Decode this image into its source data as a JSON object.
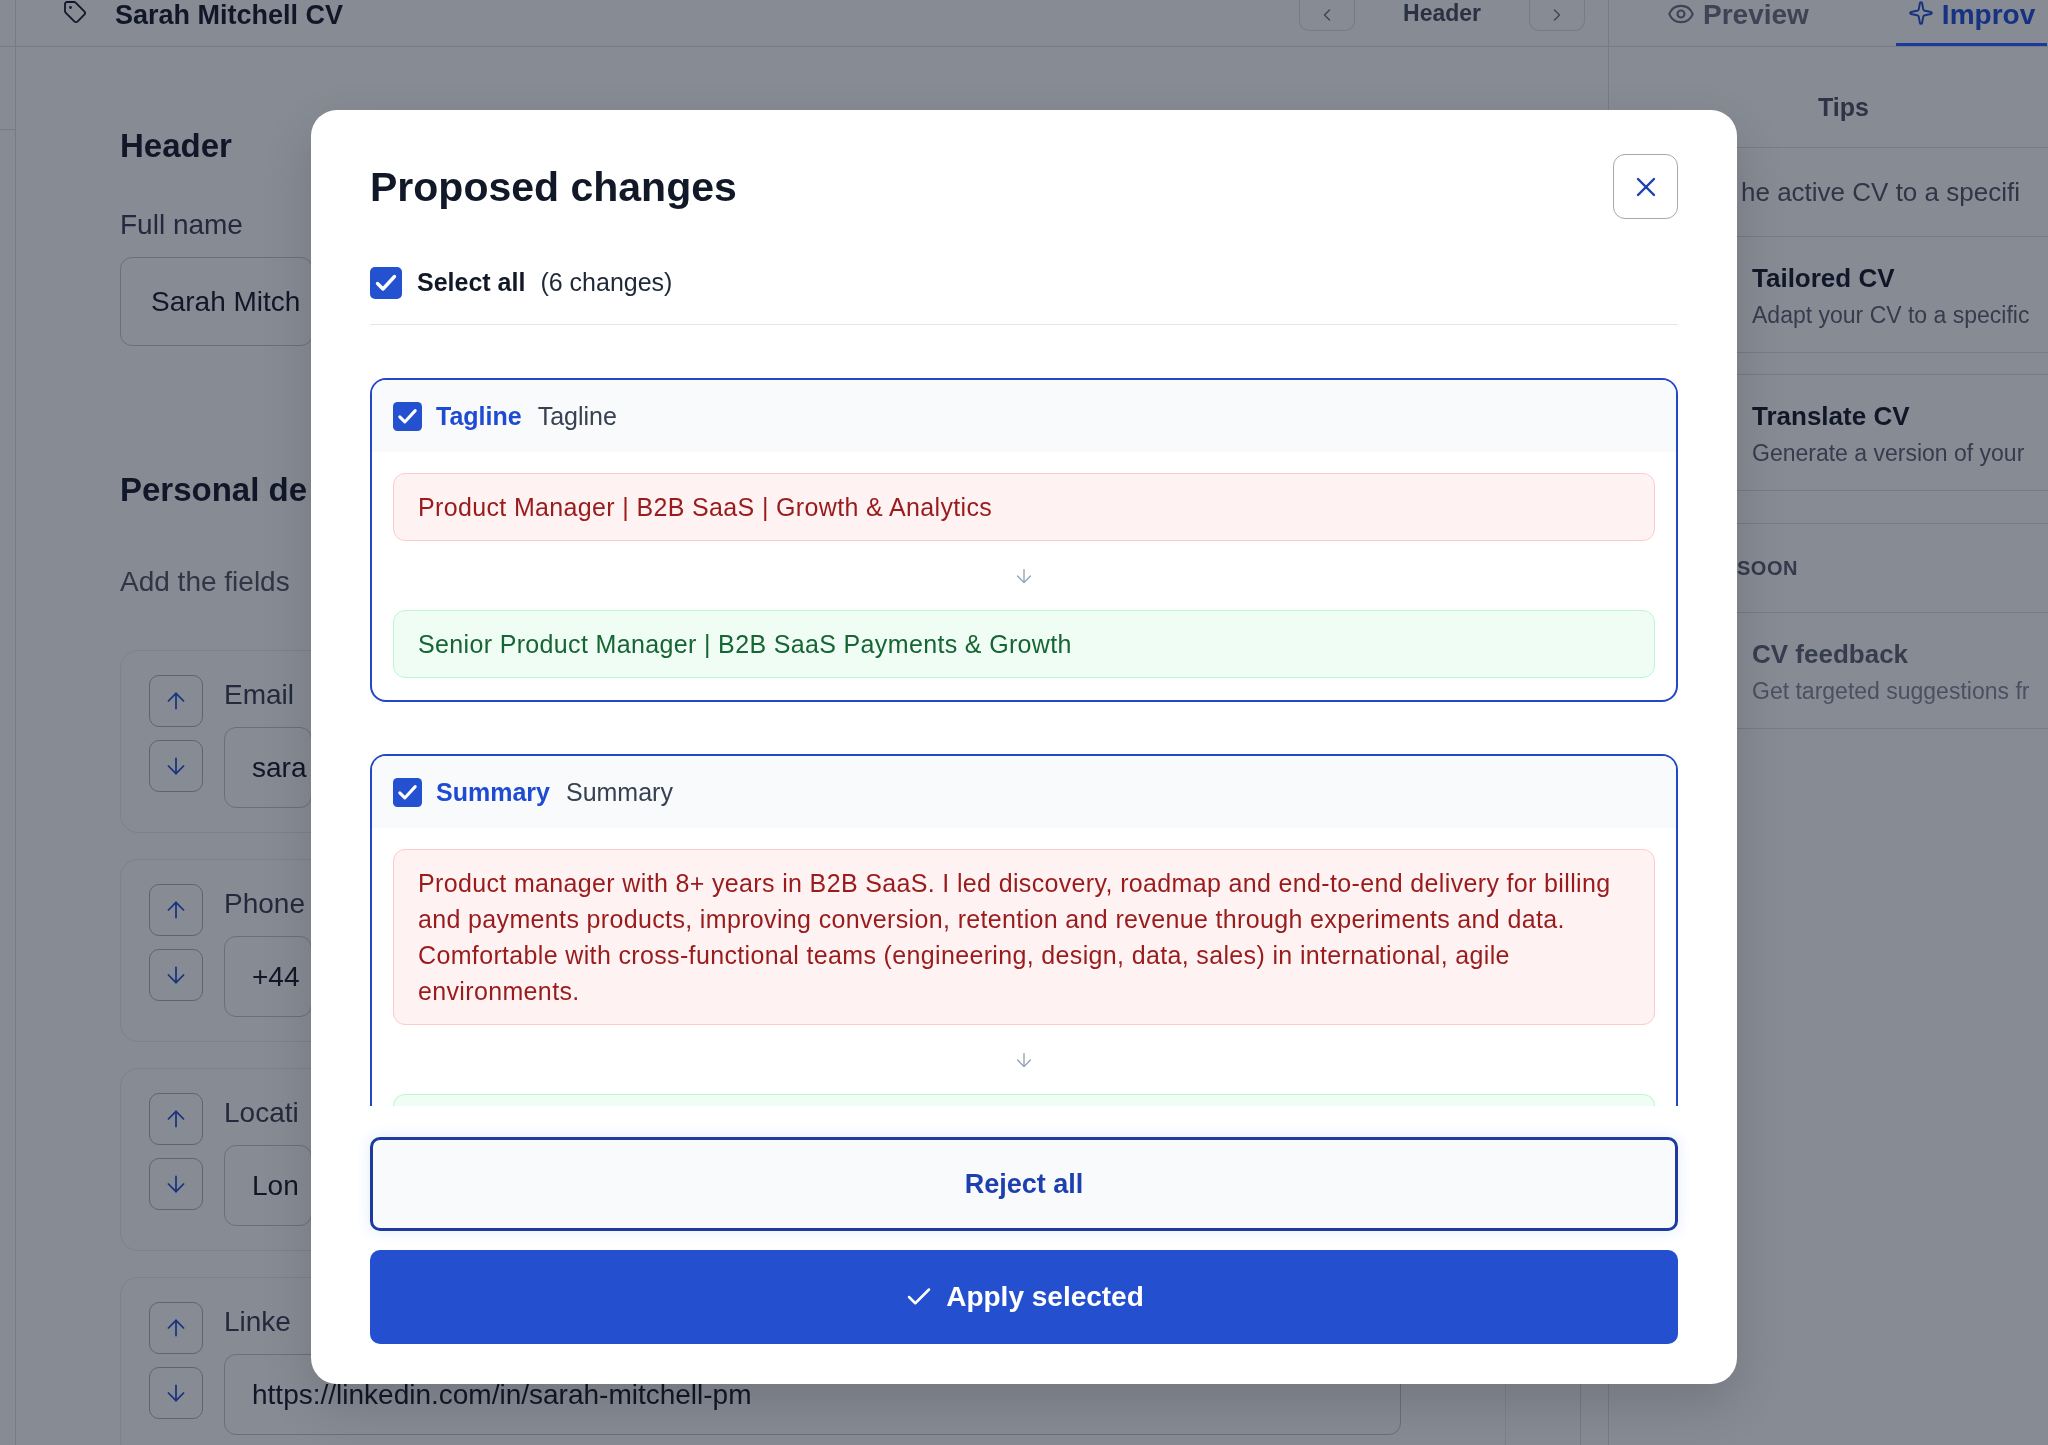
{
  "topbar": {
    "title": "Sarah Mitchell CV",
    "section": "Header"
  },
  "panel_tabs": [
    {
      "label": "Preview",
      "selected": false
    },
    {
      "label": "Improv",
      "selected": true
    }
  ],
  "editor": {
    "header_section": {
      "title": "Header",
      "field": {
        "label": "Full name",
        "value": "Sarah Mitch"
      }
    },
    "personal_section": {
      "title": "Personal de",
      "hint": "Add the fields",
      "fields": [
        {
          "label": "Email",
          "value": "sara"
        },
        {
          "label": "Phone",
          "value": "+44"
        },
        {
          "label": "Locati",
          "value": "Lon"
        },
        {
          "label": "Linke",
          "value": "https://linkedin.com/in/sarah-mitchell-pm"
        }
      ]
    }
  },
  "side_panel": {
    "heading": "Tips",
    "intro": "he active CV to a specifi",
    "groups": [
      {
        "tools": [
          {
            "title": "Tailored CV",
            "description": "Adapt your CV to a specific",
            "disabled": false
          },
          {
            "title": "Translate CV",
            "description": "Generate a version of your",
            "disabled": false
          }
        ]
      },
      {
        "heading": "SOON",
        "tools": [
          {
            "title": "CV feedback",
            "description": "Get targeted suggestions fr",
            "disabled": true
          }
        ]
      }
    ]
  },
  "dialog": {
    "title": "Proposed changes",
    "select_all": {
      "label": "Select all",
      "count": "(6 changes)",
      "checked": true
    },
    "changes": [
      {
        "title": "Tagline",
        "section": "Tagline",
        "checked": true,
        "old": "Product Manager | B2B SaaS | Growth & Analytics",
        "new": "Senior Product Manager | B2B SaaS Payments & Growth"
      },
      {
        "title": "Summary",
        "section": "Summary",
        "checked": true,
        "old": "Product manager with 8+ years in B2B SaaS. I led discovery, roadmap and end-to-end delivery for billing and payments products, improving conversion, retention and revenue through experiments and data. Comfortable with cross-functional teams (engineering, design, data, sales) in international, agile environments."
      }
    ],
    "buttons": [
      {
        "kind": "secondary",
        "label": "Reject all"
      },
      {
        "kind": "primary",
        "label": "Apply selected"
      }
    ]
  }
}
